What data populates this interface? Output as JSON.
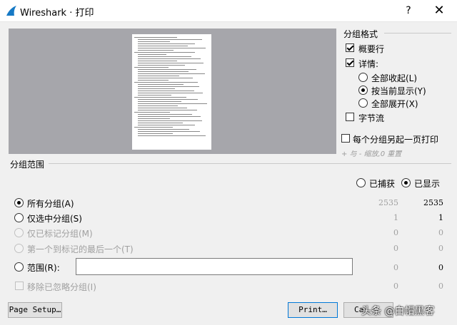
{
  "window": {
    "title": "Wireshark · 打印",
    "help_glyph": "?",
    "close_glyph": "✕"
  },
  "packet_format": {
    "title": "分组格式",
    "summary_label": "概要行",
    "details_label": "详情:",
    "collapse_all_label": "全部收起(L)",
    "as_displayed_label": "按当前显示(Y)",
    "expand_all_label": "全部展开(X)",
    "bytes_label": "字节流",
    "new_page_label": "每个分组另起一页打印",
    "zoom_hint": "+ 与 - 缩放,0 重置"
  },
  "packet_range": {
    "title": "分组范围",
    "captured_label": "已捕获",
    "displayed_label": "已显示",
    "rows": [
      {
        "label": "所有分组(A)",
        "captured": "2535",
        "displayed": "2535"
      },
      {
        "label": "仅选中分组(S)",
        "captured": "1",
        "displayed": "1"
      },
      {
        "label": "仅已标记分组(M)",
        "captured": "0",
        "displayed": "0"
      },
      {
        "label": "第一个到标记的最后一个(T)",
        "captured": "0",
        "displayed": "0"
      },
      {
        "label": "范围(R):",
        "captured": "0",
        "displayed": "0"
      },
      {
        "label": "移除已忽略分组(I)",
        "captured": "0",
        "displayed": "0"
      }
    ],
    "range_value": ""
  },
  "buttons": {
    "page_setup": "Page Setup…",
    "print": "Print…",
    "cancel": "Ca"
  },
  "watermark": "头条 @白帽黑客"
}
